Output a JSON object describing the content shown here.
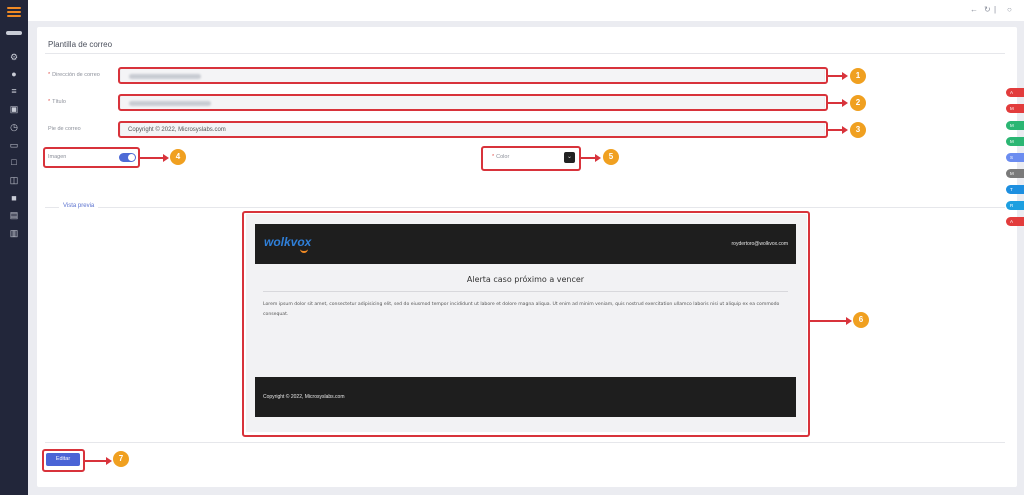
{
  "sidebar": {
    "icons": [
      "menu-icon",
      "key-icon",
      "gear-icon",
      "user-circle-icon",
      "list-icon",
      "id-card-icon",
      "clock-icon",
      "briefcase-icon",
      "monitor-icon",
      "bag-icon",
      "chat-icon",
      "screen-icon",
      "bar-chart-icon"
    ],
    "accent": "#f08a24"
  },
  "topbar": {
    "icons": [
      "arrow-left-icon",
      "refresh-icon",
      "power-icon"
    ],
    "separator": "|"
  },
  "form": {
    "title": "Plantilla de correo",
    "address_label": "Dirección de correo",
    "subject_label": "Título",
    "footer_label": "Pie de correo",
    "footer_value": "Copyright © 2022, Microsyslabs.com",
    "image_label": "Imagen",
    "image_enabled": true,
    "color_label": "Color",
    "required_marker": "*"
  },
  "preview": {
    "legend": "Vista previa",
    "logo": "wolkvox",
    "email": "roydertoro@wolkvox.com",
    "title": "Alerta caso próximo a vencer",
    "body": "Lorem ipsum dolor sit amet, consectetur adipisicing elit, sed do eiusmod tempor incididunt ut labore et dolore magna aliqua. Ut enim ad minim veniam, quis nostrud exercitation ullamco laboris nisi ut aliquip ex ea commodo consequat.",
    "footer": "Copyright © 2022, Microsyslabs.com"
  },
  "actions": {
    "edit_label": "Editar"
  },
  "annotations": {
    "badges": [
      "1",
      "2",
      "3",
      "4",
      "5",
      "6",
      "7"
    ],
    "color": "#d8333b",
    "badge_color": "#f0a020"
  },
  "right_pills": [
    {
      "label": "A",
      "color": "#e23c3c"
    },
    {
      "label": "M",
      "color": "#e23c3c"
    },
    {
      "label": "M",
      "color": "#2bb673"
    },
    {
      "label": "M",
      "color": "#2bb673"
    },
    {
      "label": "S",
      "color": "#6b8cf0"
    },
    {
      "label": "M",
      "color": "#7a7a7a"
    },
    {
      "label": "T",
      "color": "#1d8fe0"
    },
    {
      "label": "R",
      "color": "#1d9fe0"
    },
    {
      "label": "A",
      "color": "#e23c3c"
    }
  ]
}
